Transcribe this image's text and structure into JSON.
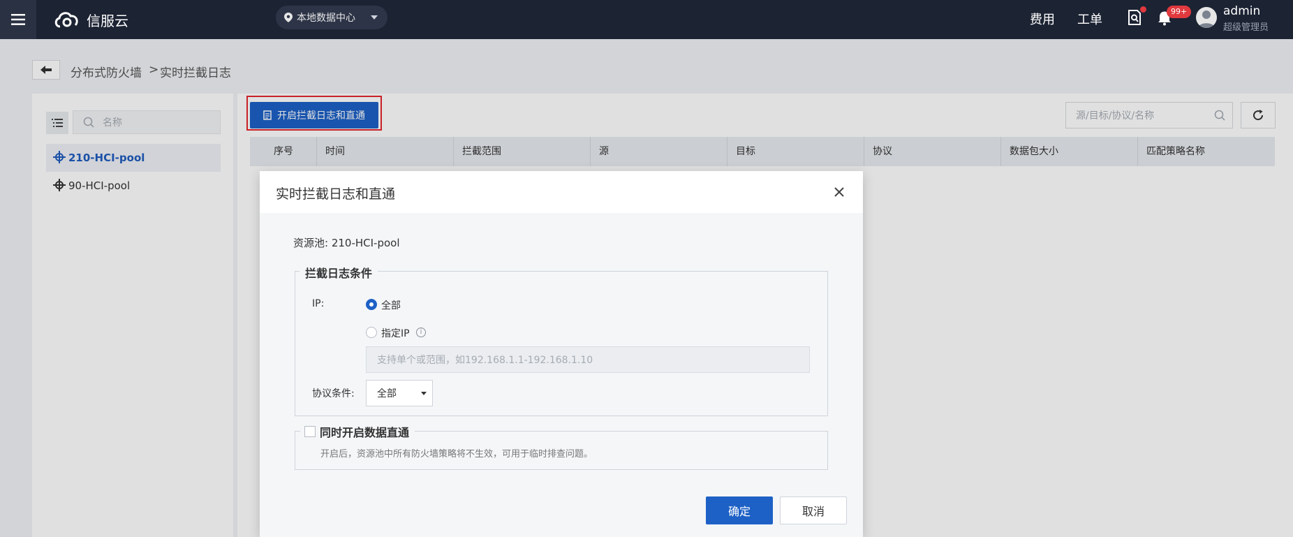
{
  "topbar": {
    "logo_text": "信服云",
    "region": "本地数据中心",
    "nav": {
      "cost": "费用",
      "tickets": "工单"
    },
    "notifications_count": "99+",
    "user": {
      "name": "admin",
      "role": "超级管理员"
    }
  },
  "breadcrumb": {
    "parent": "分布式防火墙",
    "separator": ">",
    "current": "实时拦截日志"
  },
  "left": {
    "search_placeholder": "名称",
    "pools": [
      {
        "label": "210-HCI-pool"
      },
      {
        "label": "90-HCI-pool"
      }
    ]
  },
  "main": {
    "enable_button": "开启拦截日志和直通",
    "search_placeholder": "源/目标/协议/名称",
    "columns": [
      "序号",
      "时间",
      "拦截范围",
      "源",
      "目标",
      "协议",
      "数据包大小",
      "匹配策略名称"
    ]
  },
  "modal": {
    "title": "实时拦截日志和直通",
    "pool_line": "资源池: 210-HCI-pool",
    "conditions_legend": "拦截日志条件",
    "ip_label": "IP:",
    "ip_all": "全部",
    "ip_specific": "指定IP",
    "ip_placeholder": "支持单个或范围，如192.168.1.1-192.168.1.10",
    "protocol_label": "协议条件:",
    "protocol_value": "全部",
    "passthrough_legend": "同时开启数据直通",
    "passthrough_hint": "开启后，资源池中所有防火墙策略将不生效，可用于临时排查问题。",
    "ok": "确定",
    "cancel": "取消"
  },
  "colors": {
    "primary": "#1d61c6",
    "topbar": "#1c2333",
    "highlight": "#e5262d"
  }
}
